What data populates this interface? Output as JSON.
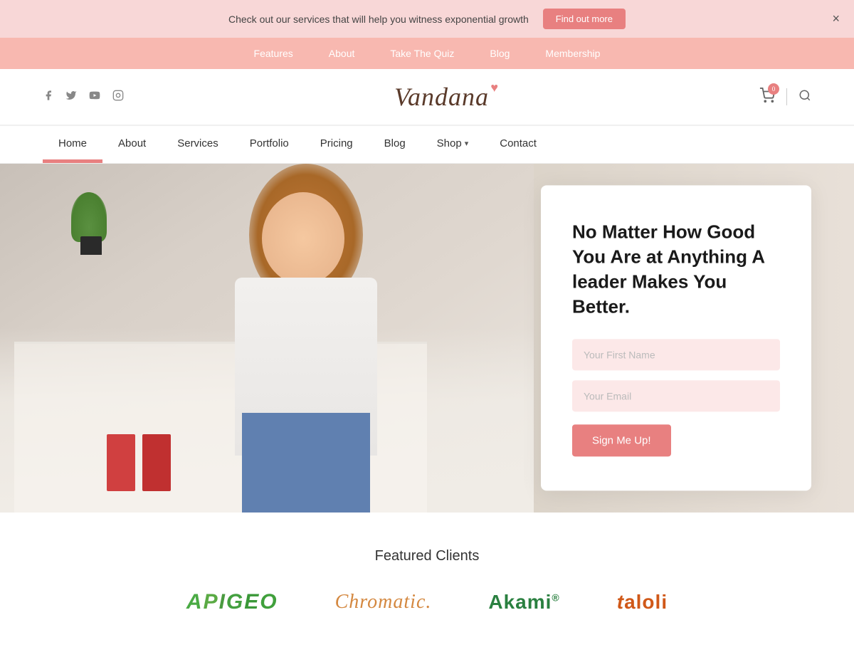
{
  "banner": {
    "text": "Check out our services that will help you witness exponential growth",
    "cta_label": "Find out more",
    "close_label": "×"
  },
  "top_nav": {
    "items": [
      {
        "label": "Features",
        "href": "#"
      },
      {
        "label": "About",
        "href": "#"
      },
      {
        "label": "Take The Quiz",
        "href": "#"
      },
      {
        "label": "Blog",
        "href": "#"
      },
      {
        "label": "Membership",
        "href": "#"
      }
    ]
  },
  "header": {
    "logo": "Vandana",
    "cart_count": "0",
    "social": [
      {
        "icon": "facebook-icon",
        "symbol": "f"
      },
      {
        "icon": "twitter-icon",
        "symbol": "t"
      },
      {
        "icon": "youtube-icon",
        "symbol": "▶"
      },
      {
        "icon": "instagram-icon",
        "symbol": "◻"
      }
    ]
  },
  "main_nav": {
    "items": [
      {
        "label": "Home",
        "active": true
      },
      {
        "label": "About",
        "active": false
      },
      {
        "label": "Services",
        "active": false
      },
      {
        "label": "Portfolio",
        "active": false
      },
      {
        "label": "Pricing",
        "active": false
      },
      {
        "label": "Blog",
        "active": false
      },
      {
        "label": "Shop",
        "active": false,
        "dropdown": true
      },
      {
        "label": "Contact",
        "active": false
      }
    ]
  },
  "hero": {
    "heading": "No Matter How Good You Are at Anything A leader Makes You Better.",
    "first_name_placeholder": "Your First Name",
    "email_placeholder": "Your Email",
    "cta_label": "Sign Me Up!"
  },
  "featured_clients": {
    "title": "Featured Clients",
    "logos": [
      {
        "name": "APIGEO",
        "style": "apigeo"
      },
      {
        "name": "Chromatic.",
        "style": "chromatic"
      },
      {
        "name": "Akami®",
        "style": "akami"
      },
      {
        "name": "taloli",
        "style": "taloli"
      }
    ]
  }
}
